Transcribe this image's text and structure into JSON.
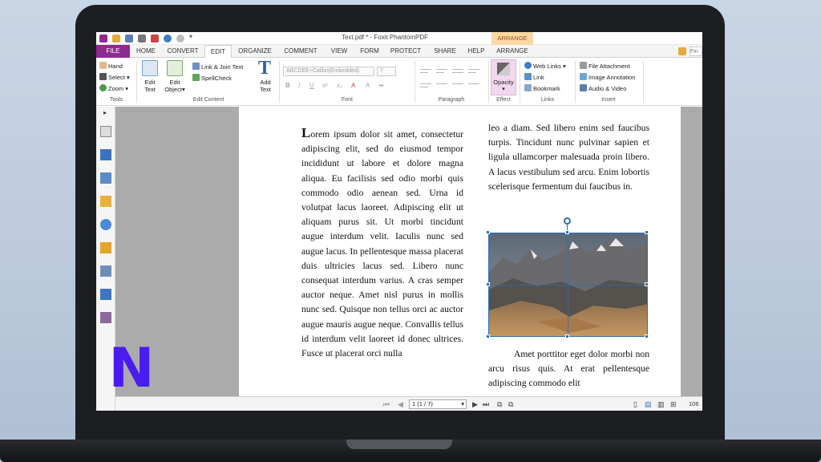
{
  "app": {
    "title": "Text.pdf * - Foxit PhantomPDF",
    "contextual_tab": "ARRANGE"
  },
  "tabs": [
    {
      "label": "FILE"
    },
    {
      "label": "HOME"
    },
    {
      "label": "CONVERT"
    },
    {
      "label": "EDIT"
    },
    {
      "label": "ORGANIZE"
    },
    {
      "label": "COMMENT"
    },
    {
      "label": "VIEW"
    },
    {
      "label": "FORM"
    },
    {
      "label": "PROTECT"
    },
    {
      "label": "SHARE"
    },
    {
      "label": "HELP"
    },
    {
      "label": "ARRANGE"
    }
  ],
  "search": {
    "placeholder": "Fin"
  },
  "ribbon": {
    "tools": {
      "hand": "Hand",
      "select": "Select",
      "zoom": "Zoom",
      "group": "Tools"
    },
    "edit_content": {
      "edit_text_1": "Edit",
      "edit_text_2": "Text",
      "edit_object_1": "Edit",
      "edit_object_2": "Object",
      "link_join": "Link & Join Text",
      "spellcheck": "SpellCheck",
      "add_text_1": "Add",
      "add_text_2": "Text",
      "group": "Edit Content"
    },
    "font": {
      "name": "ABCDEE+Calibri(Embedded)",
      "size": "7",
      "group": "Font"
    },
    "paragraph": {
      "group": "Paragraph"
    },
    "effect": {
      "opacity": "Opacity",
      "group": "Effect"
    },
    "links": {
      "web_links": "Web Links",
      "link": "Link",
      "bookmark": "Bookmark",
      "group": "Links"
    },
    "insert": {
      "file_attachment": "File Attachment",
      "image_annotation": "Image Annotation",
      "audio_video": "Audio & Video",
      "group": "Insert"
    }
  },
  "document": {
    "dropcap": "L",
    "col1": "orem ipsum dolor sit amet, consectetur adipiscing elit, sed do eiusmod tempor incididunt ut labore et dolore magna aliqua. Eu facilisis sed odio morbi quis commodo odio aenean sed. Urna id volutpat lacus laoreet. Adipiscing elit ut aliquam purus sit. Ut morbi tincidunt augue interdum velit. Iaculis nunc sed augue lacus. In pellentesque massa placerat duis ultricies lacus sed. Libero nunc consequat interdum varius. A cras semper auctor neque. Amet nisl purus in mollis nunc sed. Quisque non tellus orci ac auctor augue mauris augue neque. Convallis tellus id interdum velit laoreet id donec ultrices. Fusce ut placerat orci nulla",
    "col2": "leo a diam. Sed libero enim sed faucibus turpis. Tincidunt nunc pulvinar sapien et ligula ullamcorper malesuada proin libero. A lacus vestibulum sed arcu. Enim lobortis scelerisque fermentum dui faucibus in.",
    "col3": "Amet porttitor eget dolor morbi non arcu risus quis. At erat pellentesque adipiscing commodo elit"
  },
  "status": {
    "page_indicator": "1 (1 / 7)",
    "zoom": "106"
  },
  "brand": {
    "logo_letter": "N",
    "logo_color": "#4a1cf2",
    "accent": "#8e2b8e",
    "selection": "#2b6fb3"
  }
}
